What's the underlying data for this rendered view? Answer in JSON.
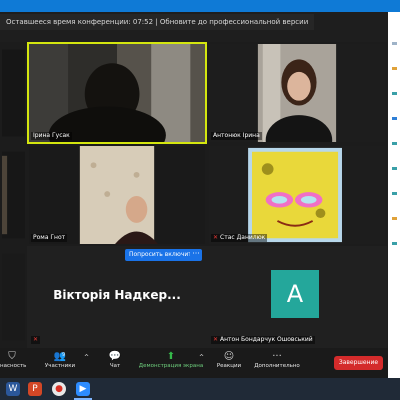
{
  "meeting": {
    "message": "Оставшееся время конференции: 07:52 | Обновите до профессиональной версии"
  },
  "participants": [
    {
      "name": "Ірина Гусак",
      "muted": false,
      "active": true
    },
    {
      "name": "Антонюк Ірина",
      "muted": false
    },
    {
      "name": "",
      "muted": false
    },
    {
      "name": "Рома Гнот",
      "muted": false
    },
    {
      "name": "Стас Данилюк",
      "muted": true
    },
    {
      "name": "",
      "muted": false
    },
    {
      "name": "Вікторія Надкер...",
      "muted": true
    },
    {
      "name": "Антон Бондарчук Ошовський",
      "muted": true,
      "avatar_letter": "A"
    }
  ],
  "ask_unmute_label": "Попросить включить",
  "more_label": "···",
  "toolbar": {
    "security_label": "насность",
    "participants_label": "Участники",
    "participants_count": "9",
    "chat_label": "Чат",
    "share_label": "Демонстрация экрана",
    "reactions_label": "Реакции",
    "more_label": "Дополнительно",
    "end_label": "Завершение"
  },
  "colors": {
    "accent": "#1a73e8",
    "active_border": "#d4e60f",
    "end": "#d42b2b",
    "avatar": "#24a79b"
  }
}
